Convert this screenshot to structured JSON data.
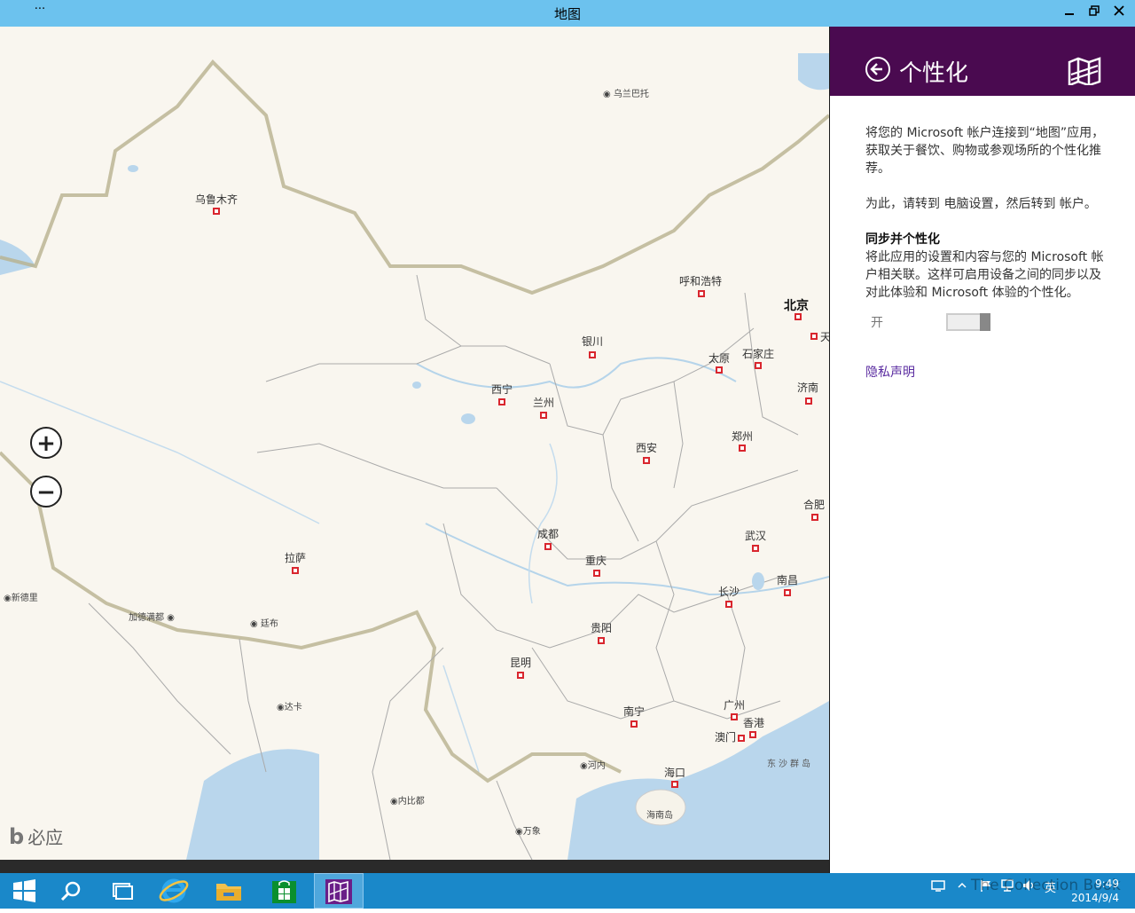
{
  "window": {
    "title": "地图",
    "menu_glyph": "···"
  },
  "map": {
    "cities": [
      {
        "name": "乌兰巴托",
        "cls": "foreign"
      },
      {
        "name": "乌鲁木齐",
        "cls": ""
      },
      {
        "name": "呼和浩特",
        "cls": ""
      },
      {
        "name": "北京",
        "cls": "big"
      },
      {
        "name": "天",
        "cls": ""
      },
      {
        "name": "银川",
        "cls": ""
      },
      {
        "name": "太原",
        "cls": ""
      },
      {
        "name": "石家庄",
        "cls": ""
      },
      {
        "name": "济南",
        "cls": ""
      },
      {
        "name": "西宁",
        "cls": ""
      },
      {
        "name": "兰州",
        "cls": ""
      },
      {
        "name": "郑州",
        "cls": ""
      },
      {
        "name": "西安",
        "cls": ""
      },
      {
        "name": "合肥",
        "cls": ""
      },
      {
        "name": "成都",
        "cls": ""
      },
      {
        "name": "武汉",
        "cls": ""
      },
      {
        "name": "拉萨",
        "cls": ""
      },
      {
        "name": "重庆",
        "cls": ""
      },
      {
        "name": "长沙",
        "cls": ""
      },
      {
        "name": "南昌",
        "cls": ""
      },
      {
        "name": "新德里",
        "cls": "foreign"
      },
      {
        "name": "加德满都",
        "cls": "foreign"
      },
      {
        "name": "廷布",
        "cls": "foreign"
      },
      {
        "name": "贵阳",
        "cls": ""
      },
      {
        "name": "昆明",
        "cls": ""
      },
      {
        "name": "达卡",
        "cls": "foreign"
      },
      {
        "name": "广州",
        "cls": ""
      },
      {
        "name": "南宁",
        "cls": ""
      },
      {
        "name": "香港",
        "cls": ""
      },
      {
        "name": "澳门",
        "cls": ""
      },
      {
        "name": "河内",
        "cls": "foreign"
      },
      {
        "name": "海口",
        "cls": ""
      },
      {
        "name": "海南岛",
        "cls": "foreign"
      },
      {
        "name": "内比都",
        "cls": "foreign"
      },
      {
        "name": "万象",
        "cls": "foreign"
      }
    ],
    "sea_label": "东沙群岛",
    "zoom_in": "+",
    "zoom_out": "−",
    "bing_logo": "b",
    "bing_text": "必应"
  },
  "panel": {
    "title": "个性化",
    "para1": "将您的 Microsoft 帐户连接到“地图”应用，获取关于餐饮、购物或参观场所的个性化推荐。",
    "para2": "为此，请转到 电脑设置，然后转到 帐户。",
    "section_title": "同步并个性化",
    "section_text": "将此应用的设置和内容与您的 Microsoft 帐户相关联。这样可启用设备之间的同步以及对此体验和 Microsoft 体验的个性化。",
    "toggle_label": "开",
    "toggle_on": true,
    "privacy_link": "隐私声明"
  },
  "taskbar": {
    "items": [
      "start",
      "search",
      "task-view",
      "internet-explorer",
      "file-explorer",
      "store",
      "maps"
    ],
    "ime": "英",
    "time": "9:49",
    "date": "2014/9/4",
    "watermark": "The Collection Book"
  }
}
